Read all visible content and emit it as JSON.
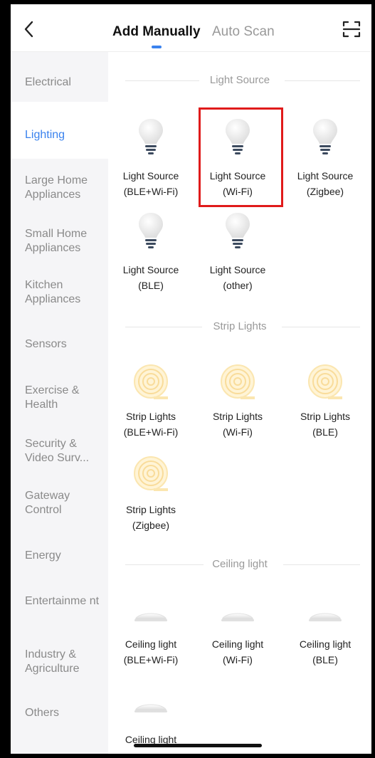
{
  "header": {
    "tabs": [
      {
        "label": "Add Manually",
        "active": true
      },
      {
        "label": "Auto Scan",
        "active": false
      }
    ],
    "back_icon": "chevron-left-icon",
    "scan_icon": "scan-frame-icon"
  },
  "sidebar": {
    "items": [
      {
        "label": "Electrical"
      },
      {
        "label": "Lighting",
        "active": true
      },
      {
        "label": "Large Home Appliances"
      },
      {
        "label": "Small Home Appliances"
      },
      {
        "label": "Kitchen Appliances"
      },
      {
        "label": "Sensors"
      },
      {
        "label": "Exercise & Health"
      },
      {
        "label": "Security & Video Surv..."
      },
      {
        "label": "Gateway Control"
      },
      {
        "label": "Energy"
      },
      {
        "label": "Entertainme nt"
      },
      {
        "label": "Industry & Agriculture"
      },
      {
        "label": "Others"
      }
    ]
  },
  "sections": [
    {
      "title": "Light Source",
      "devices": [
        {
          "line1": "Light Source",
          "line2": "(BLE+Wi-Fi)"
        },
        {
          "line1": "Light Source",
          "line2": "(Wi-Fi)",
          "highlighted": true
        },
        {
          "line1": "Light Source",
          "line2": "(Zigbee)"
        },
        {
          "line1": "Light Source",
          "line2": "(BLE)"
        },
        {
          "line1": "Light Source",
          "line2": "(other)"
        }
      ]
    },
    {
      "title": "Strip Lights",
      "devices": [
        {
          "line1": "Strip Lights",
          "line2": "(BLE+Wi-Fi)"
        },
        {
          "line1": "Strip Lights",
          "line2": "(Wi-Fi)"
        },
        {
          "line1": "Strip Lights",
          "line2": "(BLE)"
        },
        {
          "line1": "Strip Lights",
          "line2": "(Zigbee)"
        }
      ]
    },
    {
      "title": "Ceiling light",
      "devices": [
        {
          "line1": "Ceiling light",
          "line2": "(BLE+Wi-Fi)"
        },
        {
          "line1": "Ceiling light",
          "line2": "(Wi-Fi)"
        },
        {
          "line1": "Ceiling light",
          "line2": "(BLE)"
        },
        {
          "line1": "Ceiling light",
          "line2": ""
        }
      ]
    }
  ],
  "colors": {
    "accent": "#3a82ee",
    "highlight_border": "#e01b1b",
    "sidebar_bg": "#f5f5f7"
  }
}
